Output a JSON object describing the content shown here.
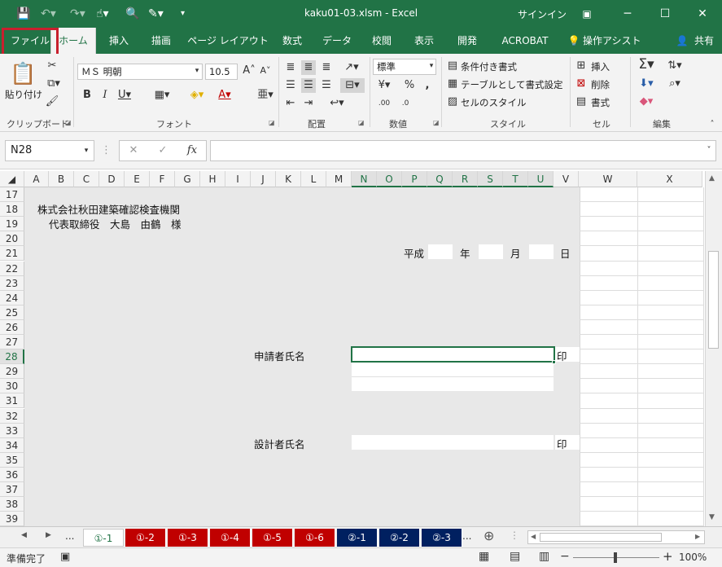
{
  "titlebar": {
    "title": "kaku01-03.xlsm  -  Excel",
    "signin": "サインイン"
  },
  "tabs": [
    "ファイル",
    "ホーム",
    "挿入",
    "描画",
    "ページ レイアウト",
    "数式",
    "データ",
    "校閲",
    "表示",
    "開発",
    "ACROBAT",
    "操作アシスト",
    "共有"
  ],
  "ribbon": {
    "paste_label": "貼り付け",
    "font_name": "ＭＳ 明朝",
    "font_size": "10.5",
    "number_format": "標準",
    "conditional_format": "条件付き書式",
    "table_format": "テーブルとして書式設定",
    "cell_style": "セルのスタイル",
    "insert": "挿入",
    "delete": "削除",
    "format": "書式",
    "groups": {
      "clipboard": "クリップボード",
      "font": "フォント",
      "alignment": "配置",
      "number": "数値",
      "style": "スタイル",
      "cells": "セル",
      "editing": "編集"
    }
  },
  "formula_bar": {
    "name_box": "N28",
    "formula": ""
  },
  "grid": {
    "columns": [
      "A",
      "B",
      "C",
      "D",
      "E",
      "F",
      "G",
      "H",
      "I",
      "J",
      "K",
      "L",
      "M",
      "N",
      "O",
      "P",
      "Q",
      "R",
      "S",
      "T",
      "U",
      "V",
      "W",
      "X"
    ],
    "rows": [
      "17",
      "18",
      "19",
      "20",
      "21",
      "22",
      "23",
      "24",
      "25",
      "26",
      "27",
      "28",
      "29",
      "30",
      "31",
      "32",
      "33",
      "34",
      "35",
      "36",
      "37",
      "38",
      "39"
    ],
    "selected_cell": "N28",
    "texts": {
      "org": "株式会社秋田建築確認検査機関",
      "rep": "代表取締役　大島　由鶴　様",
      "era": "平成",
      "year": "年",
      "month": "月",
      "day": "日",
      "applicant": "申請者氏名",
      "designer": "設計者氏名",
      "seal1": "印",
      "seal2": "印"
    }
  },
  "sheet_tabs": {
    "items": [
      {
        "label": "①-1",
        "color": "#ffffff",
        "active": true
      },
      {
        "label": "①-2",
        "color": "#c00000",
        "active": false
      },
      {
        "label": "①-3",
        "color": "#c00000",
        "active": false
      },
      {
        "label": "①-4",
        "color": "#c00000",
        "active": false
      },
      {
        "label": "①-5",
        "color": "#c00000",
        "active": false
      },
      {
        "label": "①-6",
        "color": "#c00000",
        "active": false
      },
      {
        "label": "②-1",
        "color": "#002060",
        "active": false
      },
      {
        "label": "②-2",
        "color": "#002060",
        "active": false
      },
      {
        "label": "②-3",
        "color": "#002060",
        "active": false
      }
    ],
    "ellipsis": "..."
  },
  "status": {
    "ready": "準備完了",
    "zoom": "100%"
  },
  "colors": {
    "excel_green": "#217346",
    "highlight_red": "#c8202e",
    "sheet_bg": "#e8e8e8"
  }
}
